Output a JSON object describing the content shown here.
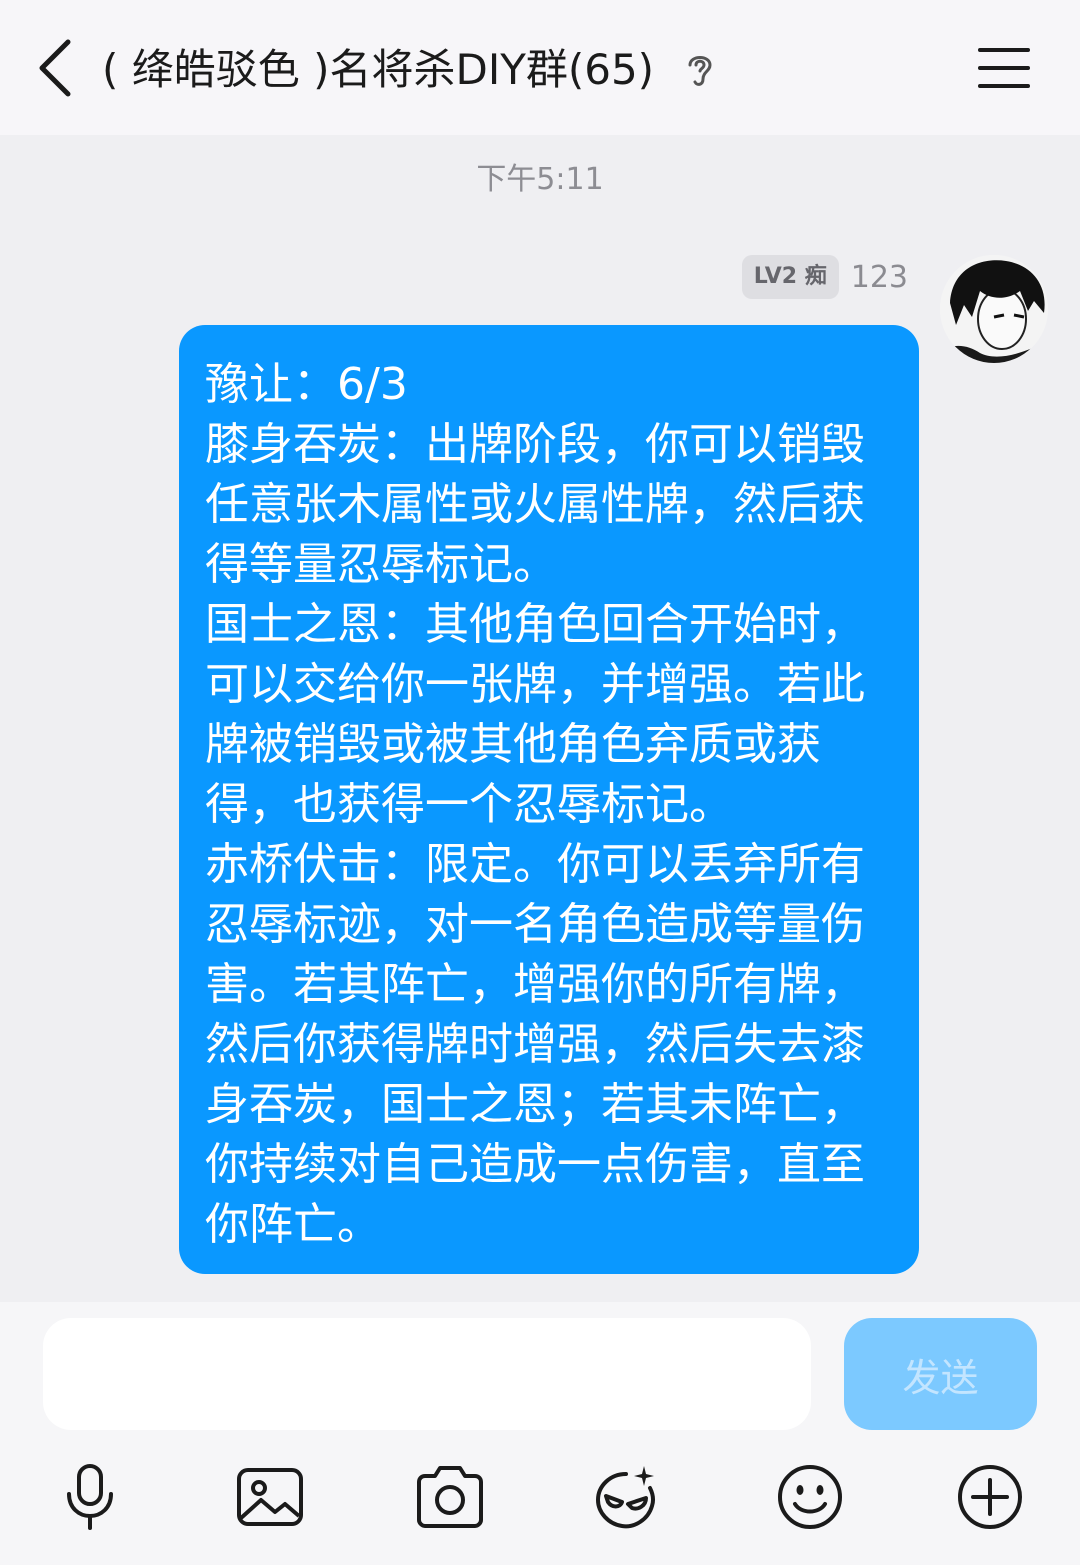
{
  "header": {
    "title": "( 绛皓驳色 )名将杀DIY群(65)",
    "back_icon": "chevron-left-icon",
    "ear_icon": "ear-icon",
    "menu_icon": "hamburger-menu-icon"
  },
  "chat": {
    "timestamp": "下午5:11",
    "messages": [
      {
        "sender_level": "LV2 痴",
        "sender_name": "123",
        "text": "豫让：6/3\n膝身吞炭：出牌阶段，你可以销毁任意张木属性或火属性牌，然后获得等量忍辱标记。\n国士之恩：其他角色回合开始时，可以交给你一张牌，并增强。若此牌被销毁或被其他角色弃质或获得，也获得一个忍辱标记。\n赤桥伏击：限定。你可以丢弃所有忍辱标迹，对一名角色造成等量伤害。若其阵亡，增强你的所有牌，然后你获得牌时增强，然后失去漆身吞炭，国士之恩；若其未阵亡，你持续对自己造成一点伤害，直至你阵亡。",
        "bubble_color": "#0a98ff"
      }
    ]
  },
  "input": {
    "placeholder": "",
    "value": "",
    "send_label": "发送"
  },
  "toolbar": {
    "icons": [
      "microphone-icon",
      "image-icon",
      "camera-icon",
      "sticker-icon",
      "emoji-icon",
      "plus-icon"
    ]
  }
}
